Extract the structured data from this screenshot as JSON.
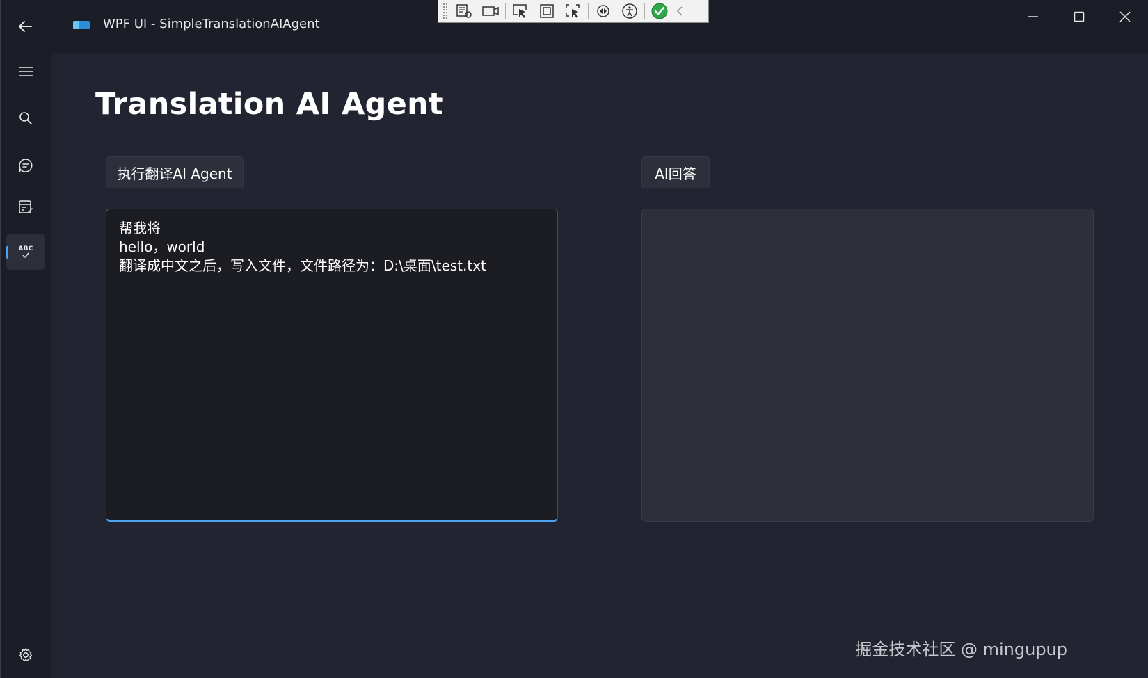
{
  "window": {
    "title": "WPF UI - SimpleTranslationAIAgent"
  },
  "debug_toolbar": {
    "icons": [
      "select-element-icon",
      "camera-icon",
      "pointer-select-icon",
      "layout-adorner-icon",
      "track-focus-icon",
      "hot-reload-icon",
      "accessibility-icon",
      "check-status-icon",
      "collapse-chevron-icon"
    ]
  },
  "sidebar": {
    "items": [
      {
        "name": "menu",
        "icon": "hamburger-icon"
      },
      {
        "name": "search",
        "icon": "search-icon"
      },
      {
        "name": "chat",
        "icon": "chat-icon"
      },
      {
        "name": "form",
        "icon": "form-edit-icon"
      },
      {
        "name": "translation",
        "icon": "abc-check-icon",
        "active": true
      }
    ],
    "abc_label": "ABC",
    "settings_icon": "gear-icon"
  },
  "main": {
    "title": "Translation AI Agent",
    "run_button_label": "执行翻译AI Agent",
    "answer_button_label": "AI回答",
    "input_text": "帮我将\nhello，world\n翻译成中文之后，写入文件，文件路径为：D:\\桌面\\test.txt",
    "output_text": ""
  },
  "watermark": "掘金技术社区 @ mingupup",
  "colors": {
    "background": "#1c1e27",
    "content": "#222531",
    "accent": "#4ca3f0",
    "input_bg": "#1c1d23",
    "output_bg": "#2d3039"
  }
}
